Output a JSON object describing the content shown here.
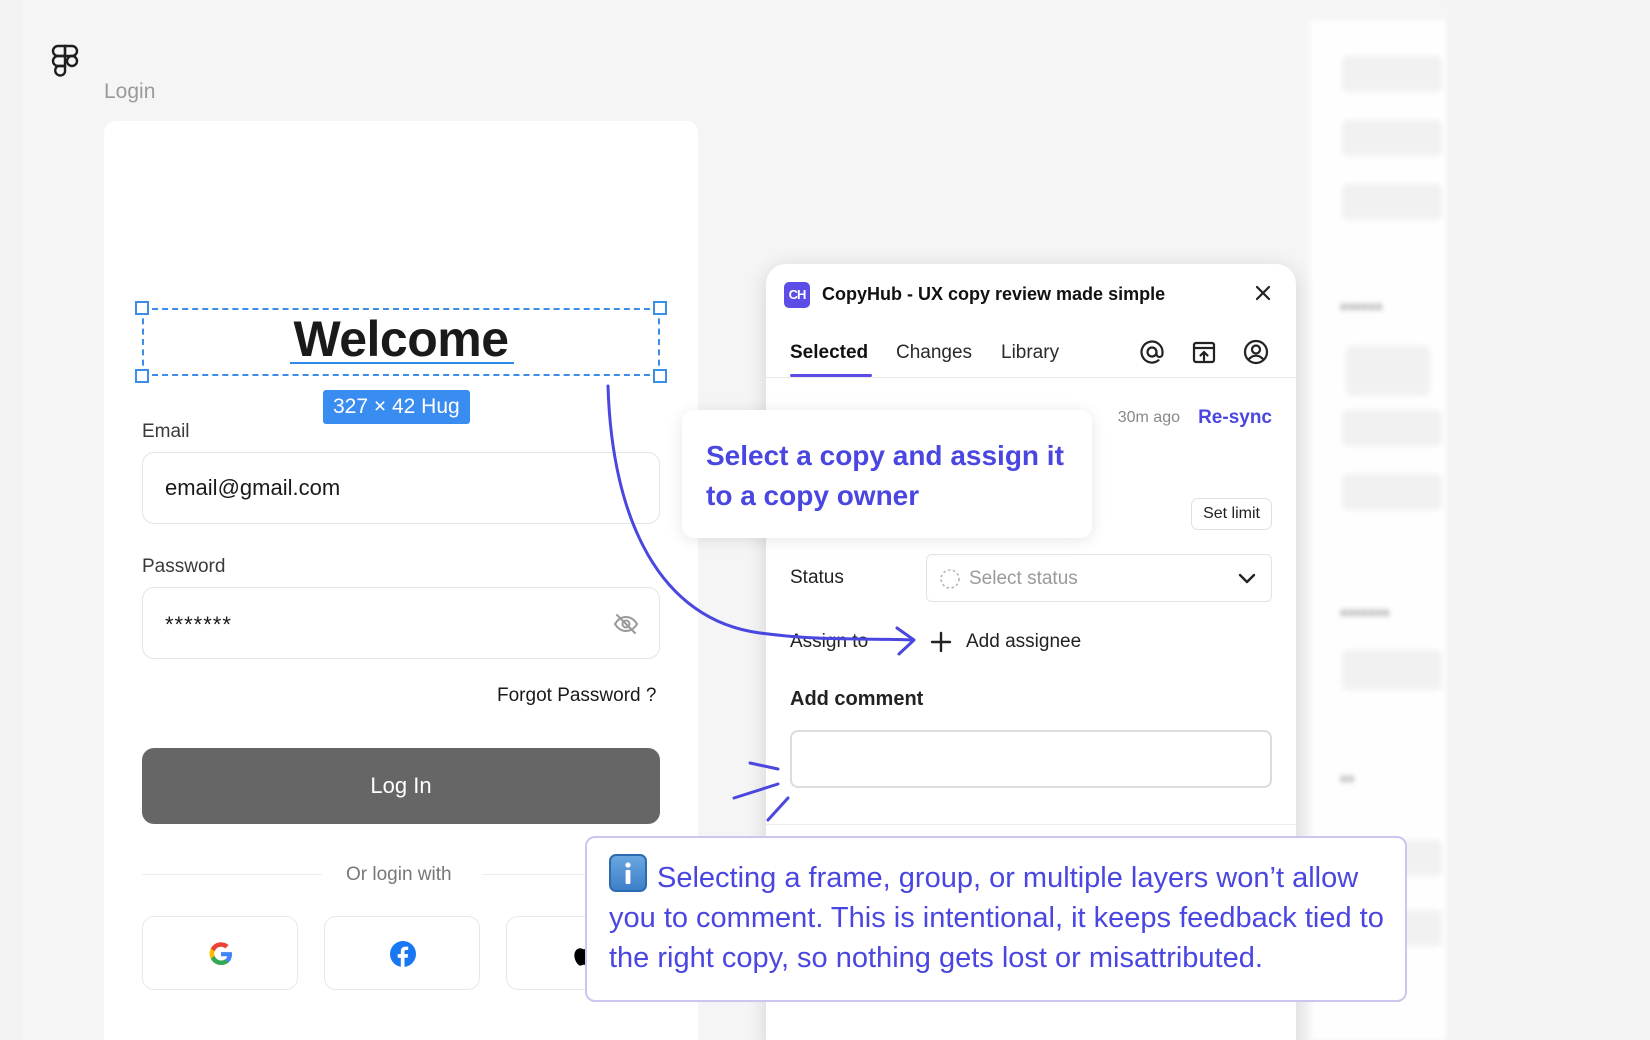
{
  "canvas": {
    "frame_label": "Login",
    "selection_dimensions": "327 × 42 Hug"
  },
  "login": {
    "heading": "Welcome",
    "email_label": "Email",
    "email_value": "email@gmail.com",
    "password_label": "Password",
    "password_value": "*******",
    "forgot_label": "Forgot Password ?",
    "login_button": "Log In",
    "or_login_with": "Or login with",
    "social": [
      "google-icon",
      "facebook-icon",
      "apple-icon"
    ]
  },
  "plugin": {
    "title": "CopyHub - UX copy review made simple",
    "logo_text": "CH",
    "tabs": [
      {
        "label": "Selected",
        "active": true
      },
      {
        "label": "Changes",
        "active": false
      },
      {
        "label": "Library",
        "active": false
      }
    ],
    "header_icons": [
      "at-sign-icon",
      "export-icon",
      "user-circle-icon"
    ],
    "sync_time": "30m ago",
    "resync_label": "Re-sync",
    "set_limit_label": "Set limit",
    "status_label": "Status",
    "status_placeholder": "Select status",
    "assign_label": "Assign to",
    "add_assignee_label": "Add assignee",
    "add_comment_label": "Add comment"
  },
  "callouts": {
    "tip": "Select a copy and assign it to a copy owner",
    "info": "Selecting a frame, group, or multiple layers won’t allow you to comment. This is intentional, it keeps feedback tied to the right copy, so nothing gets lost or misattributed."
  },
  "colors": {
    "accent": "#4a46e0",
    "selection": "#3b8de6",
    "button": "#666666"
  }
}
